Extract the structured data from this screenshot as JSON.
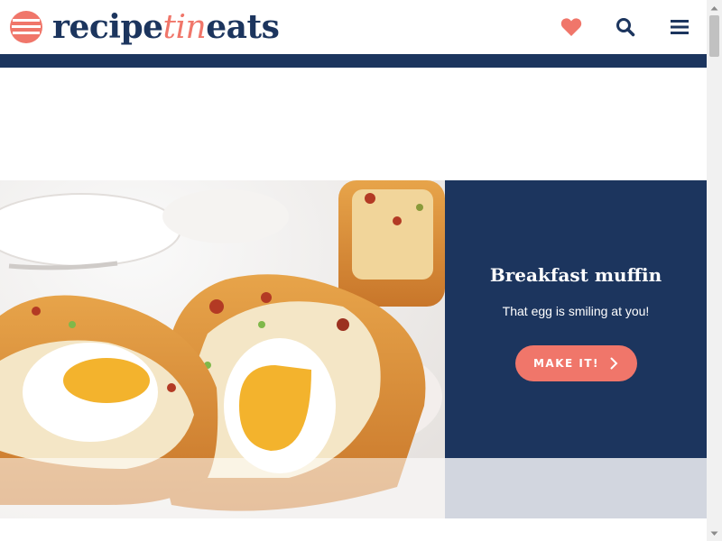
{
  "header": {
    "logo": {
      "part1": "recipe",
      "part2": "tin",
      "part3": "eats"
    },
    "icons": {
      "favorites": "heart-icon",
      "search": "search-icon",
      "menu": "hamburger-menu-icon"
    },
    "colors": {
      "navy": "#1c355e",
      "coral": "#f0766a"
    }
  },
  "hero": {
    "image": "breakfast-muffin-photo",
    "title": "Breakfast muffin",
    "subtitle": "That egg is smiling at you!",
    "button_label": "MAKE IT!",
    "button_icon": "chevron-right-icon"
  },
  "scrollbar": {
    "position": 0.0
  }
}
